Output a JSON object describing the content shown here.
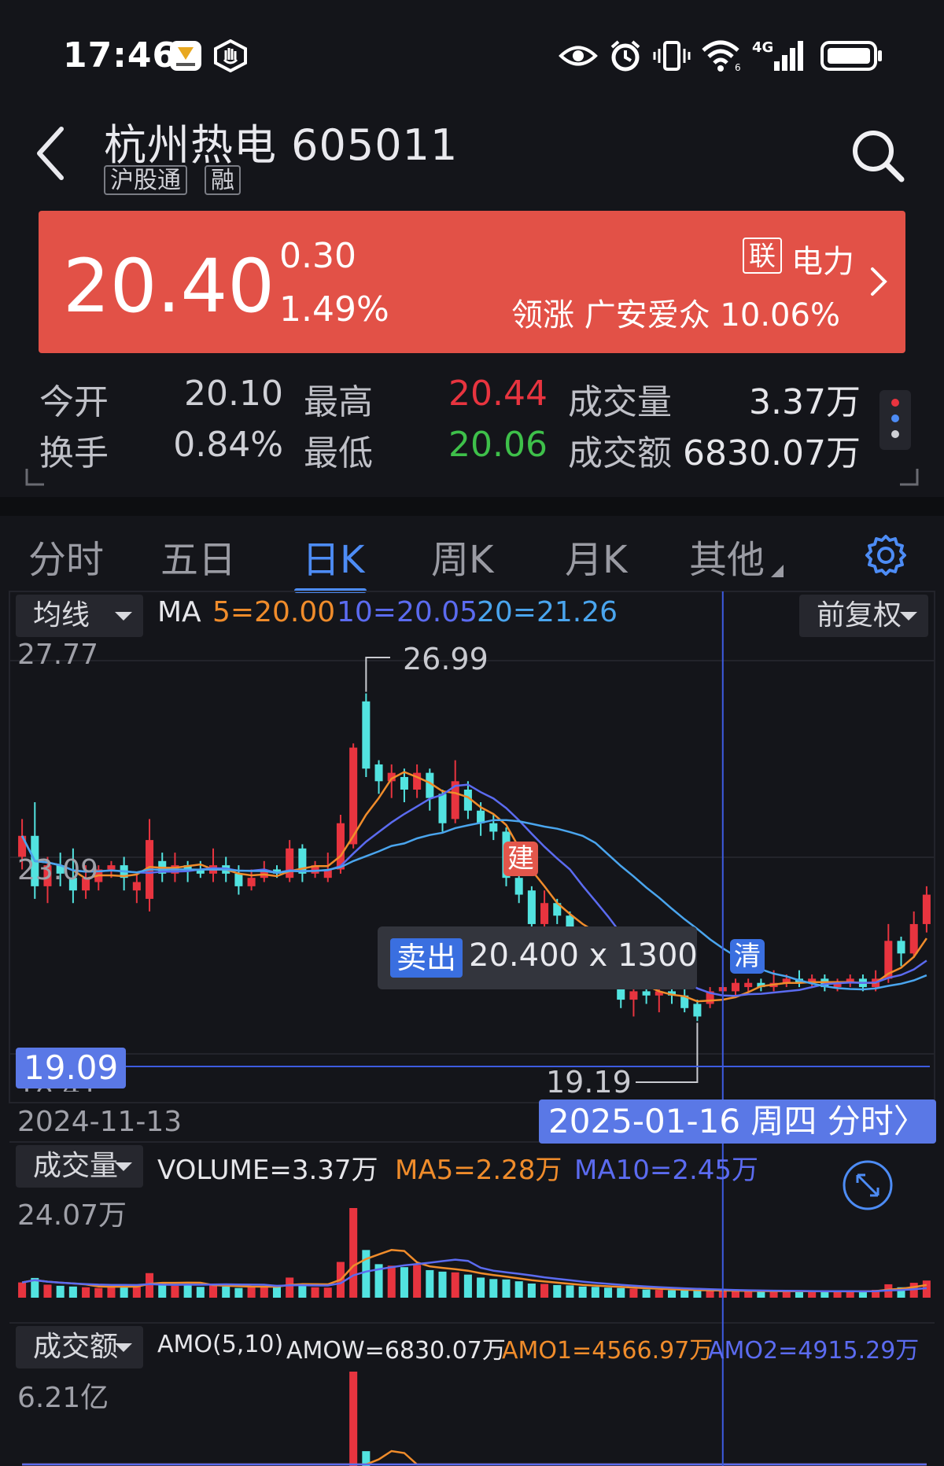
{
  "status_bar": {
    "time": "17:46",
    "network": "4G",
    "icons": [
      "honor-app-icon",
      "hand-icon",
      "eye-icon",
      "alarm-icon",
      "vibrate-icon",
      "wifi-icon",
      "signal-icon",
      "battery-icon"
    ]
  },
  "header": {
    "title": "杭州热电 605011",
    "tags": [
      "沪股通",
      "融"
    ]
  },
  "price_banner": {
    "price": "20.40",
    "change": "0.30",
    "change_pct": "1.49%",
    "sector_tag": "联",
    "sector": "电力",
    "leader": "领涨 广安爱众 10.06%",
    "bg_color": "#e25147"
  },
  "quote": {
    "open_label": "今开",
    "open": "20.10",
    "high_label": "最高",
    "high": "20.44",
    "volume_label": "成交量",
    "volume": "3.37万",
    "turnover_label": "换手",
    "turnover": "0.84%",
    "low_label": "最低",
    "low": "20.06",
    "amount_label": "成交额",
    "amount": "6830.07万"
  },
  "tabs": [
    {
      "label": "分时",
      "active": false
    },
    {
      "label": "五日",
      "active": false
    },
    {
      "label": "日K",
      "active": true
    },
    {
      "label": "周K",
      "active": false
    },
    {
      "label": "月K",
      "active": false
    },
    {
      "label": "其他",
      "active": false
    }
  ],
  "kline": {
    "indicator_select": "均线",
    "ma_prefix": "MA",
    "ma5": "5=20.00",
    "ma10": "10=20.05",
    "ma20": "20=21.26",
    "adjust_select": "前复权",
    "y_top": "27.77",
    "y_mid": "23.09",
    "y_bottom_partial": "18.41",
    "max_label": "26.99",
    "min_label": "19.19",
    "start_date": "2024-11-13",
    "cursor_date": "2025-01-16 周四 分时〉",
    "cursor_price": "19.09",
    "tooltip_badge": "卖出",
    "tooltip_text": "20.400 x 1300",
    "signal_buy": "建",
    "signal_clear": "清",
    "colors": {
      "up": "#e8343f",
      "down": "#52e3e0",
      "ma5": "#f08c2b",
      "ma10": "#5b6bf0",
      "ma20": "#4aa5ee"
    }
  },
  "volume": {
    "select": "成交量",
    "volume": "VOLUME=3.37万",
    "ma5": "MA5=2.28万",
    "ma10": "MA10=2.45万",
    "y_top": "24.07万"
  },
  "amount": {
    "select": "成交额",
    "params": "AMO(5,10)",
    "amow": "AMOW=6830.07万",
    "amo1": "AMO1=4566.97万",
    "amo2": "AMO2=4915.29万",
    "y_top": "6.21亿"
  },
  "chart_data": {
    "type": "candlestick",
    "title": "",
    "x_range": [
      "2024-11-13",
      "2025-01-16"
    ],
    "ylim": [
      18.41,
      27.77
    ],
    "y_ticks": [
      27.77,
      23.09,
      18.41
    ],
    "candles": [
      {
        "o": 23.1,
        "c": 23.6,
        "h": 24.0,
        "l": 22.8
      },
      {
        "o": 23.6,
        "c": 22.4,
        "h": 24.4,
        "l": 22.1
      },
      {
        "o": 22.4,
        "c": 22.9,
        "h": 23.1,
        "l": 22.0
      },
      {
        "o": 22.9,
        "c": 22.7,
        "h": 23.2,
        "l": 22.4
      },
      {
        "o": 22.6,
        "c": 22.3,
        "h": 23.3,
        "l": 22.0
      },
      {
        "o": 22.3,
        "c": 22.6,
        "h": 22.9,
        "l": 22.1
      },
      {
        "o": 22.5,
        "c": 22.8,
        "h": 22.9,
        "l": 22.3
      },
      {
        "o": 22.8,
        "c": 22.9,
        "h": 23.0,
        "l": 22.6
      },
      {
        "o": 22.9,
        "c": 22.6,
        "h": 23.1,
        "l": 22.3
      },
      {
        "o": 22.3,
        "c": 22.5,
        "h": 22.7,
        "l": 22.0
      },
      {
        "o": 22.1,
        "c": 23.5,
        "h": 24.0,
        "l": 21.8
      },
      {
        "o": 23.0,
        "c": 22.7,
        "h": 23.2,
        "l": 22.5
      },
      {
        "o": 22.7,
        "c": 22.9,
        "h": 23.2,
        "l": 22.5
      },
      {
        "o": 22.9,
        "c": 22.8,
        "h": 23.0,
        "l": 22.5
      },
      {
        "o": 22.8,
        "c": 22.7,
        "h": 23.0,
        "l": 22.6
      },
      {
        "o": 22.7,
        "c": 22.9,
        "h": 23.3,
        "l": 22.5
      },
      {
        "o": 22.9,
        "c": 22.7,
        "h": 23.1,
        "l": 22.5
      },
      {
        "o": 22.7,
        "c": 22.4,
        "h": 22.9,
        "l": 22.2
      },
      {
        "o": 22.4,
        "c": 22.6,
        "h": 22.8,
        "l": 22.3
      },
      {
        "o": 22.6,
        "c": 22.8,
        "h": 23.0,
        "l": 22.5
      },
      {
        "o": 22.8,
        "c": 22.7,
        "h": 22.9,
        "l": 22.6
      },
      {
        "o": 22.6,
        "c": 23.3,
        "h": 23.5,
        "l": 22.5
      },
      {
        "o": 23.3,
        "c": 22.7,
        "h": 23.4,
        "l": 22.5
      },
      {
        "o": 22.7,
        "c": 22.9,
        "h": 23.0,
        "l": 22.6
      },
      {
        "o": 22.6,
        "c": 22.8,
        "h": 23.2,
        "l": 22.5
      },
      {
        "o": 22.8,
        "c": 23.9,
        "h": 24.1,
        "l": 22.7
      },
      {
        "o": 23.4,
        "c": 25.7,
        "h": 25.8,
        "l": 23.3
      },
      {
        "o": 26.8,
        "c": 25.2,
        "h": 26.99,
        "l": 25.0
      },
      {
        "o": 25.3,
        "c": 24.9,
        "h": 25.4,
        "l": 24.6
      },
      {
        "o": 24.9,
        "c": 25.1,
        "h": 25.3,
        "l": 24.5
      },
      {
        "o": 25.0,
        "c": 24.7,
        "h": 25.2,
        "l": 24.4
      },
      {
        "o": 24.7,
        "c": 25.1,
        "h": 25.3,
        "l": 24.5
      },
      {
        "o": 25.1,
        "c": 24.5,
        "h": 25.2,
        "l": 24.2
      },
      {
        "o": 24.6,
        "c": 23.9,
        "h": 24.7,
        "l": 23.7
      },
      {
        "o": 24.0,
        "c": 24.9,
        "h": 25.4,
        "l": 23.9
      },
      {
        "o": 24.7,
        "c": 24.2,
        "h": 24.9,
        "l": 24.0
      },
      {
        "o": 24.2,
        "c": 23.9,
        "h": 24.4,
        "l": 23.6
      },
      {
        "o": 23.9,
        "c": 23.7,
        "h": 24.1,
        "l": 23.5
      },
      {
        "o": 23.7,
        "c": 22.6,
        "h": 23.8,
        "l": 22.4
      },
      {
        "o": 22.6,
        "c": 22.2,
        "h": 22.8,
        "l": 22.0
      },
      {
        "o": 22.3,
        "c": 21.5,
        "h": 22.4,
        "l": 21.3
      },
      {
        "o": 21.5,
        "c": 22.0,
        "h": 22.3,
        "l": 21.4
      },
      {
        "o": 22.0,
        "c": 21.7,
        "h": 22.1,
        "l": 21.5
      },
      {
        "o": 21.7,
        "c": 21.3,
        "h": 21.8,
        "l": 21.0
      },
      {
        "o": 21.3,
        "c": 21.0,
        "h": 21.4,
        "l": 20.8
      },
      {
        "o": 21.0,
        "c": 20.6,
        "h": 21.1,
        "l": 20.4
      },
      {
        "o": 20.8,
        "c": 20.2,
        "h": 20.9,
        "l": 20.0
      },
      {
        "o": 20.2,
        "c": 19.7,
        "h": 20.4,
        "l": 19.5
      },
      {
        "o": 19.7,
        "c": 19.9,
        "h": 20.2,
        "l": 19.3
      },
      {
        "o": 19.9,
        "c": 19.8,
        "h": 20.1,
        "l": 19.6
      },
      {
        "o": 19.8,
        "c": 19.9,
        "h": 20.0,
        "l": 19.4
      },
      {
        "o": 19.9,
        "c": 19.8,
        "h": 20.0,
        "l": 19.6
      },
      {
        "o": 19.8,
        "c": 19.5,
        "h": 20.0,
        "l": 19.4
      },
      {
        "o": 19.6,
        "c": 19.3,
        "h": 19.7,
        "l": 19.19
      },
      {
        "o": 19.6,
        "c": 19.9,
        "h": 20.0,
        "l": 19.5
      },
      {
        "o": 19.9,
        "c": 20.0,
        "h": 20.1,
        "l": 19.8
      },
      {
        "o": 19.9,
        "c": 20.1,
        "h": 20.2,
        "l": 19.8
      },
      {
        "o": 20.0,
        "c": 20.1,
        "h": 20.2,
        "l": 19.9
      },
      {
        "o": 20.1,
        "c": 20.0,
        "h": 20.2,
        "l": 19.9
      },
      {
        "o": 20.0,
        "c": 20.1,
        "h": 20.4,
        "l": 19.9
      },
      {
        "o": 20.1,
        "c": 20.2,
        "h": 20.3,
        "l": 20.0
      },
      {
        "o": 20.2,
        "c": 20.1,
        "h": 20.4,
        "l": 20.0
      },
      {
        "o": 20.1,
        "c": 20.2,
        "h": 20.3,
        "l": 20.0
      },
      {
        "o": 20.2,
        "c": 20.0,
        "h": 20.3,
        "l": 19.9
      },
      {
        "o": 20.0,
        "c": 20.1,
        "h": 20.2,
        "l": 19.9
      },
      {
        "o": 20.1,
        "c": 20.2,
        "h": 20.3,
        "l": 20.0
      },
      {
        "o": 20.2,
        "c": 20.0,
        "h": 20.3,
        "l": 19.9
      },
      {
        "o": 20.0,
        "c": 20.2,
        "h": 20.4,
        "l": 19.9
      },
      {
        "o": 20.2,
        "c": 21.1,
        "h": 21.5,
        "l": 20.1
      },
      {
        "o": 21.1,
        "c": 20.8,
        "h": 21.2,
        "l": 20.5
      },
      {
        "o": 20.8,
        "c": 21.5,
        "h": 21.8,
        "l": 20.7
      },
      {
        "o": 21.5,
        "c": 22.2,
        "h": 22.4,
        "l": 21.3
      }
    ],
    "volumes": [
      4.1,
      5.3,
      3.5,
      3.2,
      3.0,
      2.8,
      2.6,
      3.1,
      3.3,
      3.0,
      6.6,
      3.9,
      3.2,
      3.5,
      2.9,
      3.4,
      3.0,
      2.6,
      3.0,
      2.8,
      3.4,
      5.4,
      3.6,
      2.8,
      2.7,
      9.6,
      24.07,
      12.8,
      9.0,
      8.6,
      8.2,
      8.8,
      7.4,
      7.0,
      6.8,
      6.2,
      5.4,
      5.0,
      4.9,
      4.4,
      3.8,
      3.7,
      3.4,
      3.3,
      3.0,
      2.9,
      2.7,
      2.6,
      2.4,
      2.2,
      2.1,
      2.0,
      2.0,
      1.9,
      1.9,
      1.8,
      1.8,
      1.7,
      1.8,
      1.7,
      1.7,
      1.8,
      1.7,
      1.6,
      1.7,
      1.8,
      1.7,
      2.1,
      3.6,
      2.8,
      4.0,
      4.6
    ]
  }
}
